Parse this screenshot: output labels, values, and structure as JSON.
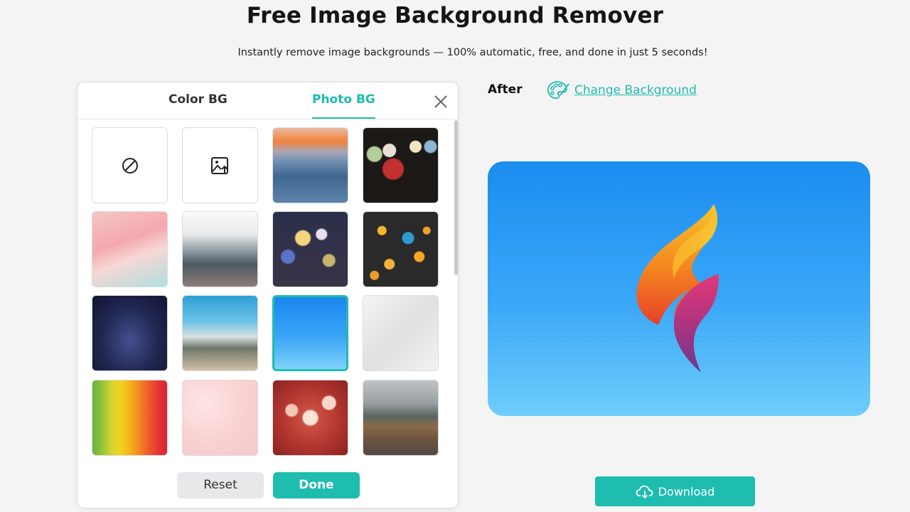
{
  "header": {
    "title": "Free Image Background Remover",
    "subtitle": "Instantly remove image backgrounds — 100% automatic, free, and done in just 5 seconds!"
  },
  "panel": {
    "tabs": [
      {
        "label": "Color BG",
        "active": false
      },
      {
        "label": "Photo BG",
        "active": true
      }
    ],
    "close_icon": "close-icon",
    "tiles": [
      {
        "name": "no-background",
        "icon": "no-background-icon"
      },
      {
        "name": "upload-photo",
        "icon": "upload-image-icon"
      },
      {
        "name": "sunset-sea"
      },
      {
        "name": "rainy-bokeh-dark"
      },
      {
        "name": "pink-brush-strokes"
      },
      {
        "name": "raindrops-window"
      },
      {
        "name": "rain-night-lights"
      },
      {
        "name": "golden-bokeh"
      },
      {
        "name": "starry-sky"
      },
      {
        "name": "tropical-beach"
      },
      {
        "name": "blue-gradient",
        "selected": true
      },
      {
        "name": "white-texture"
      },
      {
        "name": "rainbow-stripes"
      },
      {
        "name": "pink-clouds"
      },
      {
        "name": "red-bokeh"
      },
      {
        "name": "mountain-road"
      }
    ],
    "reset_label": "Reset",
    "done_label": "Done"
  },
  "preview": {
    "after_label": "After",
    "change_background_label": "Change Background",
    "palette_icon": "palette-icon",
    "logo_icon": "flame-logo-icon"
  },
  "download": {
    "label": "Download",
    "icon": "cloud-download-icon"
  },
  "colors": {
    "accent": "#1fbcb0",
    "page_bg": "#f4f4f4"
  }
}
